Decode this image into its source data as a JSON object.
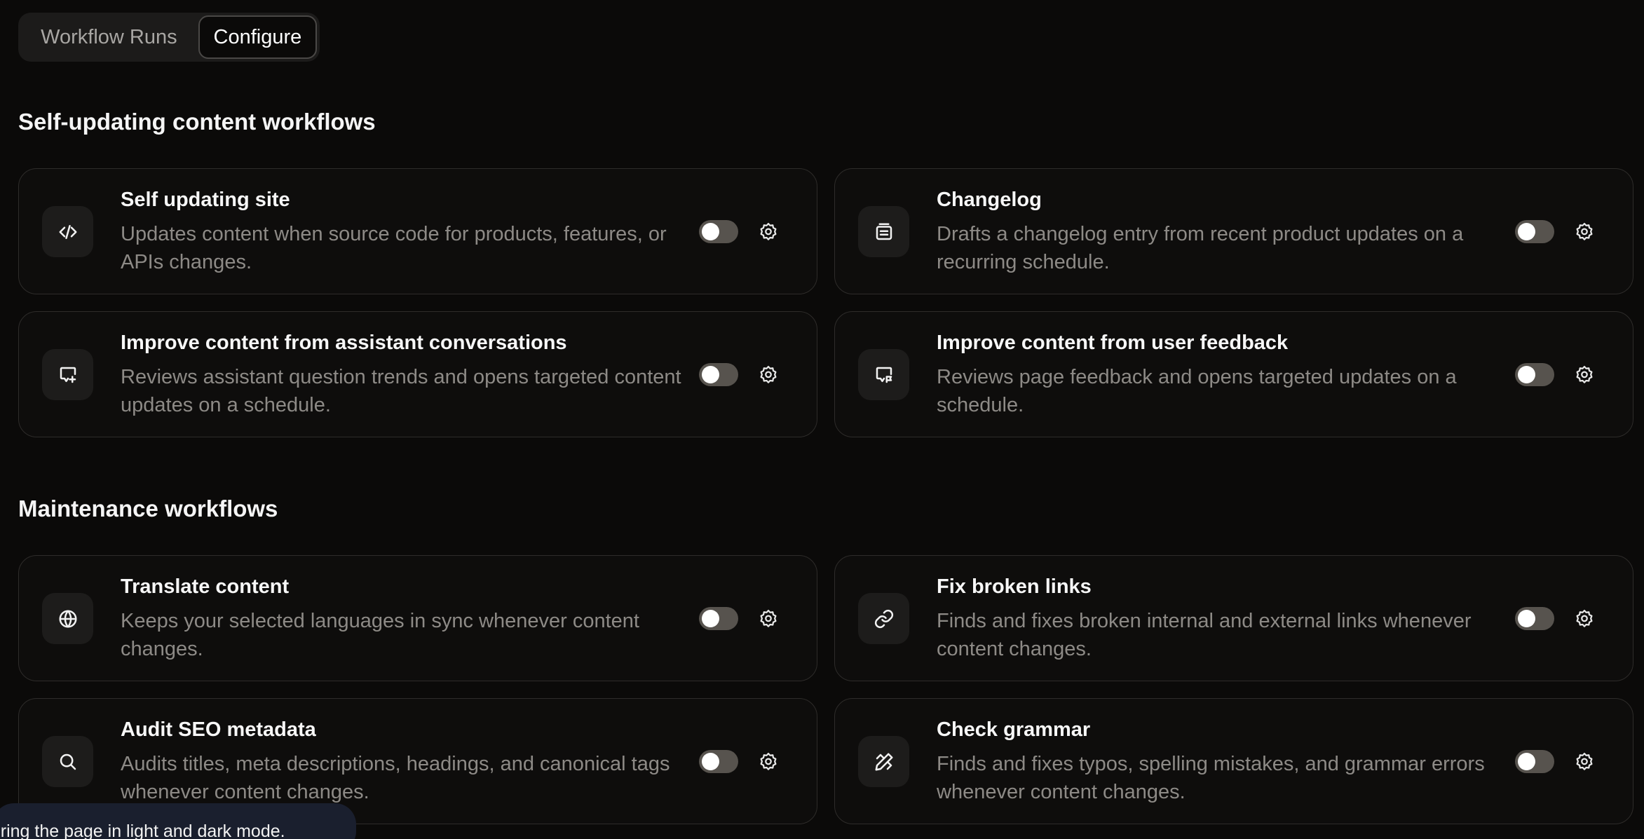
{
  "tabs": {
    "workflow_runs": "Workflow Runs",
    "configure": "Configure",
    "active": "configure"
  },
  "sections": [
    {
      "title": "Self-updating content workflows",
      "cards": [
        {
          "title": "Self updating site",
          "description": "Updates content when source code for products, features, or APIs changes.",
          "icon": "code-icon",
          "enabled": false
        },
        {
          "title": "Changelog",
          "description": "Drafts a changelog entry from recent product updates on a recurring schedule.",
          "icon": "changelog-icon",
          "enabled": false
        },
        {
          "title": "Improve content from assistant conversations",
          "description": "Reviews assistant question trends and opens targeted content updates on a schedule.",
          "icon": "chat-sparkle-icon",
          "enabled": false
        },
        {
          "title": "Improve content from user feedback",
          "description": "Reviews page feedback and opens targeted updates on a schedule.",
          "icon": "feedback-icon",
          "enabled": false
        }
      ]
    },
    {
      "title": "Maintenance workflows",
      "cards": [
        {
          "title": "Translate content",
          "description": "Keeps your selected languages in sync whenever content changes.",
          "icon": "globe-icon",
          "enabled": false
        },
        {
          "title": "Fix broken links",
          "description": "Finds and fixes broken internal and external links whenever content changes.",
          "icon": "link-icon",
          "enabled": false
        },
        {
          "title": "Audit SEO metadata",
          "description": "Audits titles, meta descriptions, headings, and canonical tags whenever content changes.",
          "icon": "search-icon",
          "enabled": false
        },
        {
          "title": "Check grammar",
          "description": "Finds and fixes typos, spelling mistakes, and grammar errors whenever content changes.",
          "icon": "pencil-ruler-icon",
          "enabled": false
        }
      ]
    }
  ],
  "toast": {
    "text": "pturing the page in light and dark mode."
  },
  "colors": {
    "background": "#0b0a09",
    "card_border": "#2e2c2a",
    "toggle_off": "#57534e",
    "description": "#8d8a86",
    "toast_bg": "#1a1f2e"
  }
}
